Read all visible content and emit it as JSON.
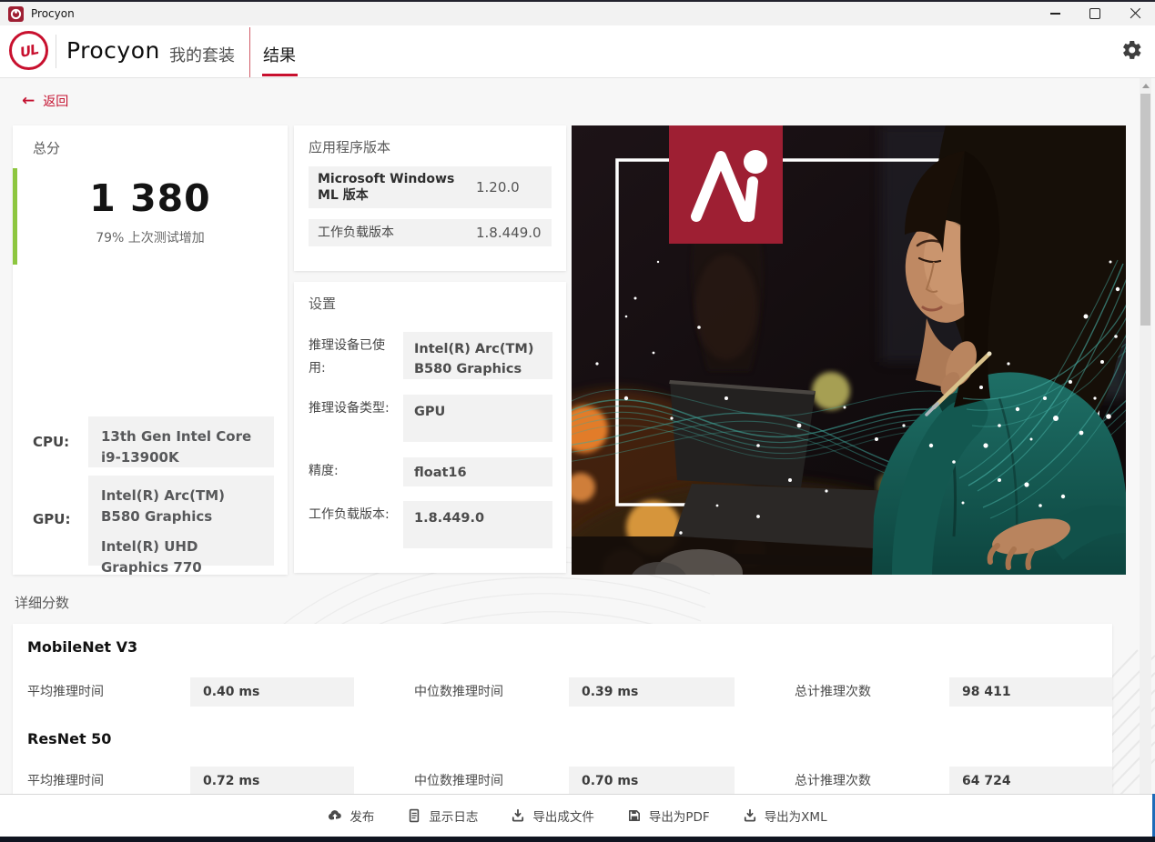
{
  "titlebar": {
    "title": "Procyon"
  },
  "header": {
    "brand": "Procyon",
    "tabs": [
      {
        "label": "我的套装"
      },
      {
        "label": "结果"
      }
    ],
    "settings_icon": "gear-icon"
  },
  "back": {
    "label": "返回"
  },
  "score_card": {
    "title": "总分",
    "score": "1 380",
    "subtitle": "79% 上次测试增加",
    "cpu_label": "CPU:",
    "cpu_value": "13th Gen Intel Core i9-13900K",
    "gpu_label": "GPU:",
    "gpu_values": [
      "Intel(R) Arc(TM) B580 Graphics",
      "Intel(R) UHD Graphics 770"
    ]
  },
  "app_version_card": {
    "title": "应用程序版本",
    "rows": [
      {
        "label": "Microsoft Windows ML 版本",
        "value": "1.20.0"
      },
      {
        "label": "工作负载版本",
        "value": "1.8.449.0"
      }
    ]
  },
  "settings_card": {
    "title": "设置",
    "rows": [
      {
        "label": "推理设备已使用:",
        "value": "Intel(R) Arc(TM) B580 Graphics"
      },
      {
        "label": "推理设备类型:",
        "value": "GPU"
      },
      {
        "label": "精度:",
        "value": "float16"
      },
      {
        "label": "工作负载版本:",
        "value": "1.8.449.0"
      }
    ]
  },
  "detail": {
    "section_title": "详细分数",
    "groups": [
      {
        "name": "MobileNet V3",
        "metrics": [
          {
            "label": "平均推理时间",
            "value": "0.40 ms"
          },
          {
            "label": "中位数推理时间",
            "value": "0.39 ms"
          },
          {
            "label": "总计推理次数",
            "value": "98 411"
          }
        ]
      },
      {
        "name": "ResNet 50",
        "metrics": [
          {
            "label": "平均推理时间",
            "value": "0.72 ms"
          },
          {
            "label": "中位数推理时间",
            "value": "0.70 ms"
          },
          {
            "label": "总计推理次数",
            "value": "64 724"
          }
        ]
      }
    ]
  },
  "footer": {
    "buttons": [
      {
        "label": "发布",
        "icon": "cloud-upload-icon"
      },
      {
        "label": "显示日志",
        "icon": "document-icon"
      },
      {
        "label": "导出成文件",
        "icon": "download-icon"
      },
      {
        "label": "导出为PDF",
        "icon": "save-icon"
      },
      {
        "label": "导出为XML",
        "icon": "download-icon"
      }
    ]
  },
  "colors": {
    "accent_red": "#c8102e",
    "score_green": "#8dc63f",
    "hero_square_red": "#9e1f33"
  }
}
